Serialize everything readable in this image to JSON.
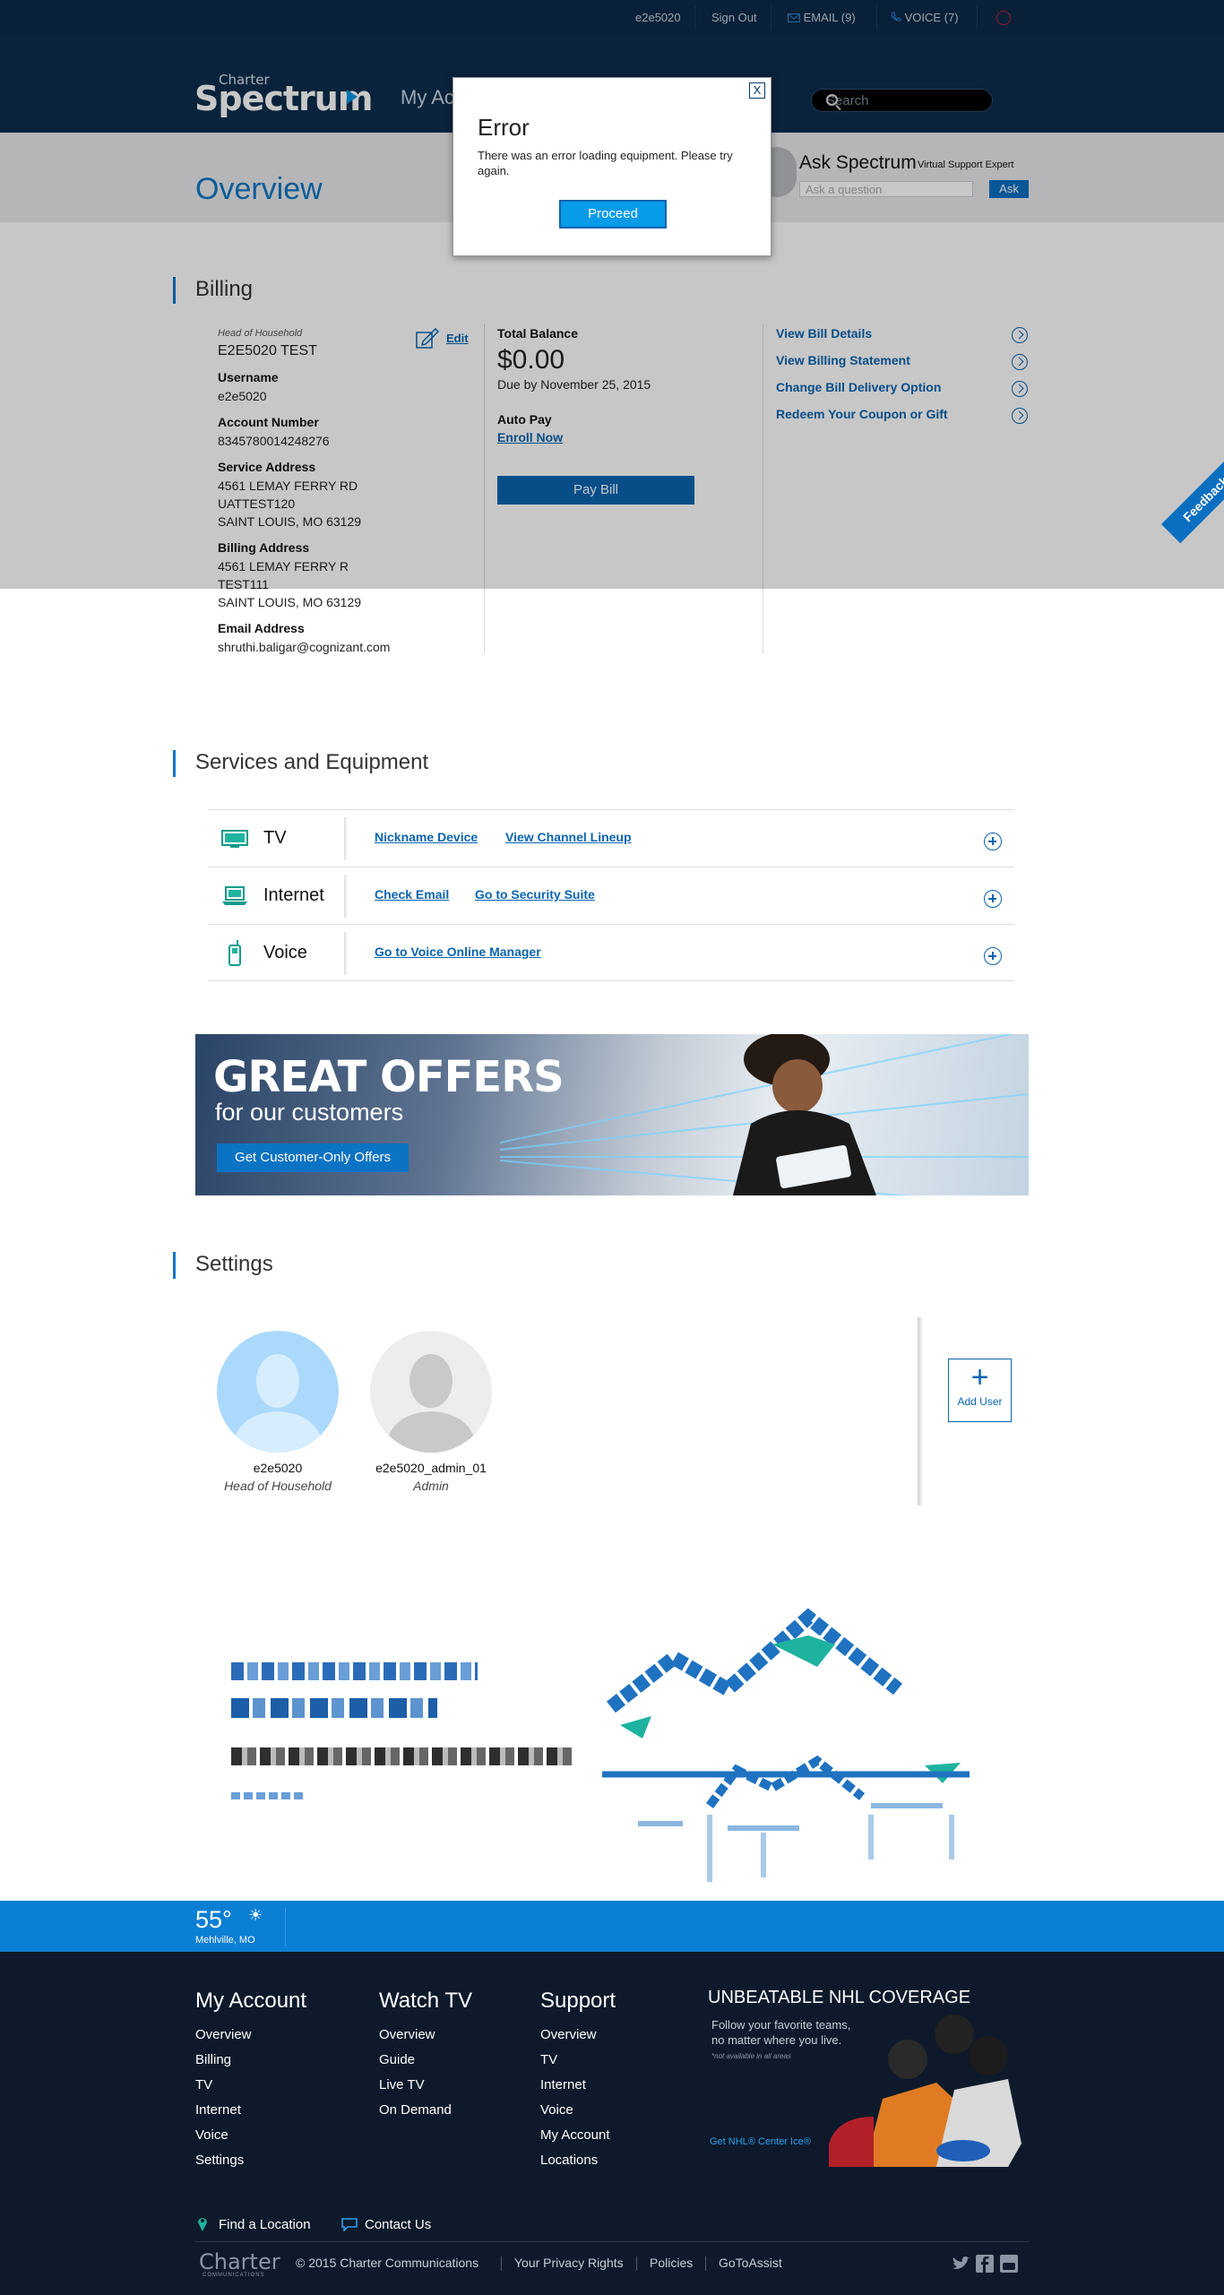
{
  "top": {
    "user": "e2e5020",
    "sign_out": "Sign Out",
    "email": "EMAIL",
    "email_count": "(9)",
    "voice": "VOICE",
    "voice_count": "(7)"
  },
  "header": {
    "logo_small": "Charter",
    "logo_big": "Spectrum",
    "nav": "My Ac",
    "search_placeholder": "Search"
  },
  "overview": {
    "title": "Overview",
    "ask_title": "Ask Spectrum",
    "ask_sub": "Virtual Support Expert",
    "ask_placeholder": "Ask a question",
    "ask_button": "Ask"
  },
  "modal": {
    "title": "Error",
    "message": "There was an error loading equipment. Please try again.",
    "button": "Proceed",
    "close": "X"
  },
  "billing": {
    "heading": "Billing",
    "hoh_label": "Head of Household",
    "name": "E2E5020 TEST",
    "edit": "Edit",
    "username_label": "Username",
    "username": "e2e5020",
    "account_label": "Account Number",
    "account": "8345780014248276",
    "service_label": "Service Address",
    "service_l1": "4561 LEMAY FERRY RD",
    "service_l2": "UATTEST120",
    "service_l3": "SAINT LOUIS, MO 63129",
    "billing_label": "Billing Address",
    "billing_l1": "4561 LEMAY FERRY R",
    "billing_l2": "TEST111",
    "billing_l3": "SAINT LOUIS, MO 63129",
    "email_label": "Email Address",
    "email": "shruthi.baligar@cognizant.com",
    "balance_label": "Total Balance",
    "balance": "$0.00",
    "due": "Due by November 25, 2015",
    "autopay_label": "Auto Pay",
    "enroll": "Enroll Now",
    "pay": "Pay Bill",
    "links": [
      "View Bill Details",
      "View Billing Statement",
      "Change Bill Delivery Option",
      "Redeem Your Coupon or Gift"
    ]
  },
  "feedback": "Feedback",
  "services": {
    "heading": "Services and Equipment",
    "rows": [
      {
        "name": "TV",
        "links": [
          "Nickname Device",
          "View Channel Lineup"
        ]
      },
      {
        "name": "Internet",
        "links": [
          "Check Email",
          "Go to Security Suite"
        ]
      },
      {
        "name": "Voice",
        "links": [
          "Go to Voice Online Manager"
        ]
      }
    ]
  },
  "offers": {
    "headline": "GREAT OFFERS",
    "sub": "for our customers",
    "button": "Get Customer-Only Offers"
  },
  "settings": {
    "heading": "Settings",
    "users": [
      {
        "name": "e2e5020",
        "role": "Head of Household"
      },
      {
        "name": "e2e5020_admin_01",
        "role": "Admin"
      }
    ],
    "add_user": "Add User"
  },
  "weather": {
    "temp": "55°",
    "location": "Mehlville, MO"
  },
  "footer": {
    "col1": {
      "title": "My Account",
      "items": [
        "Overview",
        "Billing",
        "TV",
        "Internet",
        "Voice",
        "Settings"
      ]
    },
    "col2": {
      "title": "Watch TV",
      "items": [
        "Overview",
        "Guide",
        "Live TV",
        "On Demand"
      ]
    },
    "col3": {
      "title": "Support",
      "items": [
        "Overview",
        "TV",
        "Internet",
        "Voice",
        "My Account",
        "Locations"
      ]
    },
    "promo": {
      "title": "UNBEATABLE NHL COVERAGE",
      "line1": "Follow your favorite teams,",
      "line2": "no matter where you live.",
      "note": "*not available in all areas",
      "link": "Get NHL® Center Ice®"
    },
    "find_location": "Find a Location",
    "contact": "Contact Us",
    "logo": "Charter",
    "logo_sub": "COMMUNICATIONS",
    "copyright": "© 2015 Charter Communications",
    "privacy": "Your Privacy Rights",
    "policies": "Policies",
    "gotoassist": "GoToAssist"
  },
  "colors": {
    "brand": "#0c2d4d",
    "accent": "#0a64b0",
    "weather": "#0b7fd4",
    "footer": "#0e1a2b"
  }
}
